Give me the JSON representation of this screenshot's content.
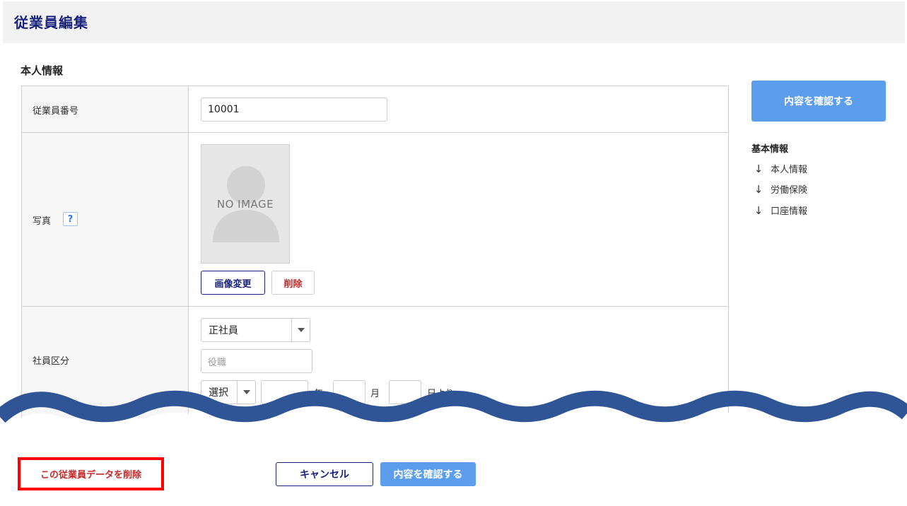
{
  "header": {
    "title": "従業員編集"
  },
  "section": {
    "title": "本人情報"
  },
  "rows": {
    "employee_number": {
      "label": "従業員番号",
      "value": "10001"
    },
    "photo": {
      "label": "写真",
      "help": "?",
      "placeholder_text": "NO IMAGE",
      "change_label": "画像変更",
      "delete_label": "削除"
    },
    "employee_type": {
      "label": "社員区分",
      "type_value": "正社員",
      "position_placeholder": "役職",
      "era_value": "選択",
      "year_unit": "年",
      "month_unit": "月",
      "day_unit": "日より"
    }
  },
  "sidebar": {
    "confirm_label": "内容を確認する",
    "heading": "基本情報",
    "links": [
      {
        "label": "本人情報",
        "icon": "arrow-down-icon"
      },
      {
        "label": "労働保険",
        "icon": "arrow-down-icon"
      },
      {
        "label": "口座情報",
        "icon": "arrow-down-icon"
      }
    ]
  },
  "footer": {
    "delete_label": "この従業員データを削除",
    "cancel_label": "キャンセル",
    "confirm_label": "内容を確認する"
  },
  "colors": {
    "title": "#1a237e",
    "primary": "#5c9ded",
    "danger": "#c62828",
    "highlight": "#ff0000",
    "wave": "#2f5597"
  }
}
